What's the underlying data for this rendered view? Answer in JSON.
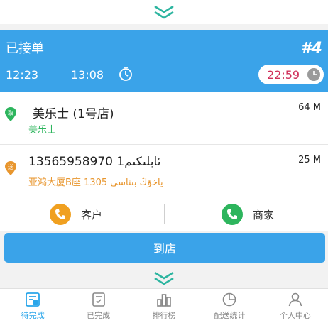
{
  "order": {
    "status": "已接单",
    "number": "#4",
    "time_start": "12:23",
    "time_end": "13:08",
    "deadline": "22:59"
  },
  "pickup": {
    "badge": "取",
    "title": "美乐士 (1号店)",
    "subtitle": "美乐士",
    "distance": "64 M"
  },
  "delivery": {
    "badge": "送",
    "title": "13565958970 1ئابلىكىم",
    "subtitle": "亚鸿大厦B座 1305 ياخۇڭ بىناسى",
    "distance": "25 M"
  },
  "contacts": {
    "customer_label": "客户",
    "merchant_label": "商家"
  },
  "actions": {
    "arrive_label": "到店"
  },
  "tabs": [
    {
      "label": "待完成",
      "icon": "pending-icon"
    },
    {
      "label": "已完成",
      "icon": "completed-icon"
    },
    {
      "label": "排行榜",
      "icon": "ranking-icon"
    },
    {
      "label": "配送统计",
      "icon": "stats-icon"
    },
    {
      "label": "个人中心",
      "icon": "profile-icon"
    }
  ],
  "colors": {
    "primary": "#3aa3e9",
    "pickup_green": "#2db55d",
    "delivery_orange": "#e8962e",
    "deadline_red": "#d0305a"
  }
}
